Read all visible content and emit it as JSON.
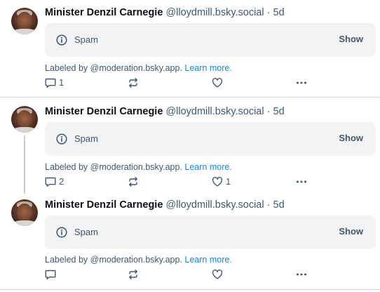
{
  "posts": [
    {
      "author": "Minister Denzil Carnegie",
      "handle": "@lloydmill.bsky.social",
      "separator": "·",
      "time": "5d",
      "label": "Spam",
      "show_label": "Show",
      "labeled_by_prefix": "Labeled by @moderation.bsky.app.",
      "learn_more": "Learn more.",
      "reply_count": "1",
      "repost_count": "",
      "like_count": ""
    },
    {
      "author": "Minister Denzil Carnegie",
      "handle": "@lloydmill.bsky.social",
      "separator": "·",
      "time": "5d",
      "label": "Spam",
      "show_label": "Show",
      "labeled_by_prefix": "Labeled by @moderation.bsky.app.",
      "learn_more": "Learn more.",
      "reply_count": "2",
      "repost_count": "",
      "like_count": "1"
    },
    {
      "author": "Minister Denzil Carnegie",
      "handle": "@lloydmill.bsky.social",
      "separator": "·",
      "time": "5d",
      "label": "Spam",
      "show_label": "Show",
      "labeled_by_prefix": "Labeled by @moderation.bsky.app.",
      "learn_more": "Learn more.",
      "reply_count": "",
      "repost_count": "",
      "like_count": ""
    }
  ],
  "icons": {
    "info": "info-icon",
    "reply": "reply-icon",
    "repost": "repost-icon",
    "like": "heart-icon",
    "more": "more-icon"
  },
  "colors": {
    "muted_text": "#42576c",
    "link": "#1083fe",
    "label_background": "#f1f3f5",
    "divider": "#d4dbe2",
    "thread_line": "#c5d0db"
  }
}
